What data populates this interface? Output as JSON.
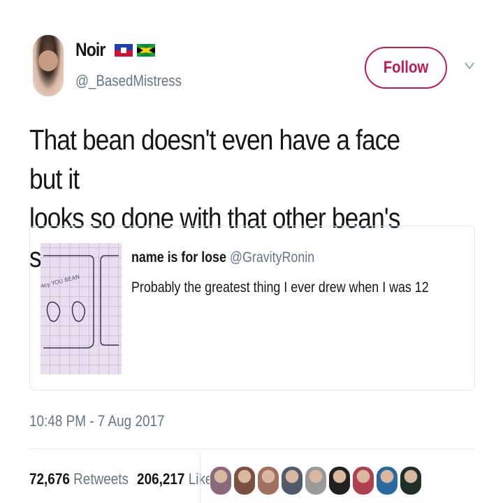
{
  "user": {
    "display_name": "Noir",
    "handle": "@_BasedMistress",
    "flags": [
      "haiti-flag-icon",
      "jamaica-flag-icon"
    ]
  },
  "follow_label": "Follow",
  "tweet_text": "That bean doesn't even have a face but it\nlooks so done with that other bean's shit",
  "quote": {
    "name": "name is for lose",
    "handle": "@GravityRonin",
    "text": "Probably the greatest thing I ever drew when I was 12",
    "image_scrawl": "Hey YOU BEAN"
  },
  "timestamp": "10:48 PM - 7 Aug 2017",
  "stats": {
    "retweets_count": "72,676",
    "retweets_label": "Retweets",
    "likes_count": "206,217",
    "likes_label": "Likes"
  },
  "likers": [
    {
      "color": "#8a6a7a"
    },
    {
      "color": "#7a5040"
    },
    {
      "color": "#a07060"
    },
    {
      "color": "#505a6a"
    },
    {
      "color": "#9a9a9a"
    },
    {
      "color": "#202020"
    },
    {
      "color": "#b04050"
    },
    {
      "color": "#2a6aa0"
    },
    {
      "color": "#203028"
    }
  ],
  "colors": {
    "accent": "#c2185b",
    "secondary_text": "#657786",
    "border": "#e1e8ed"
  }
}
